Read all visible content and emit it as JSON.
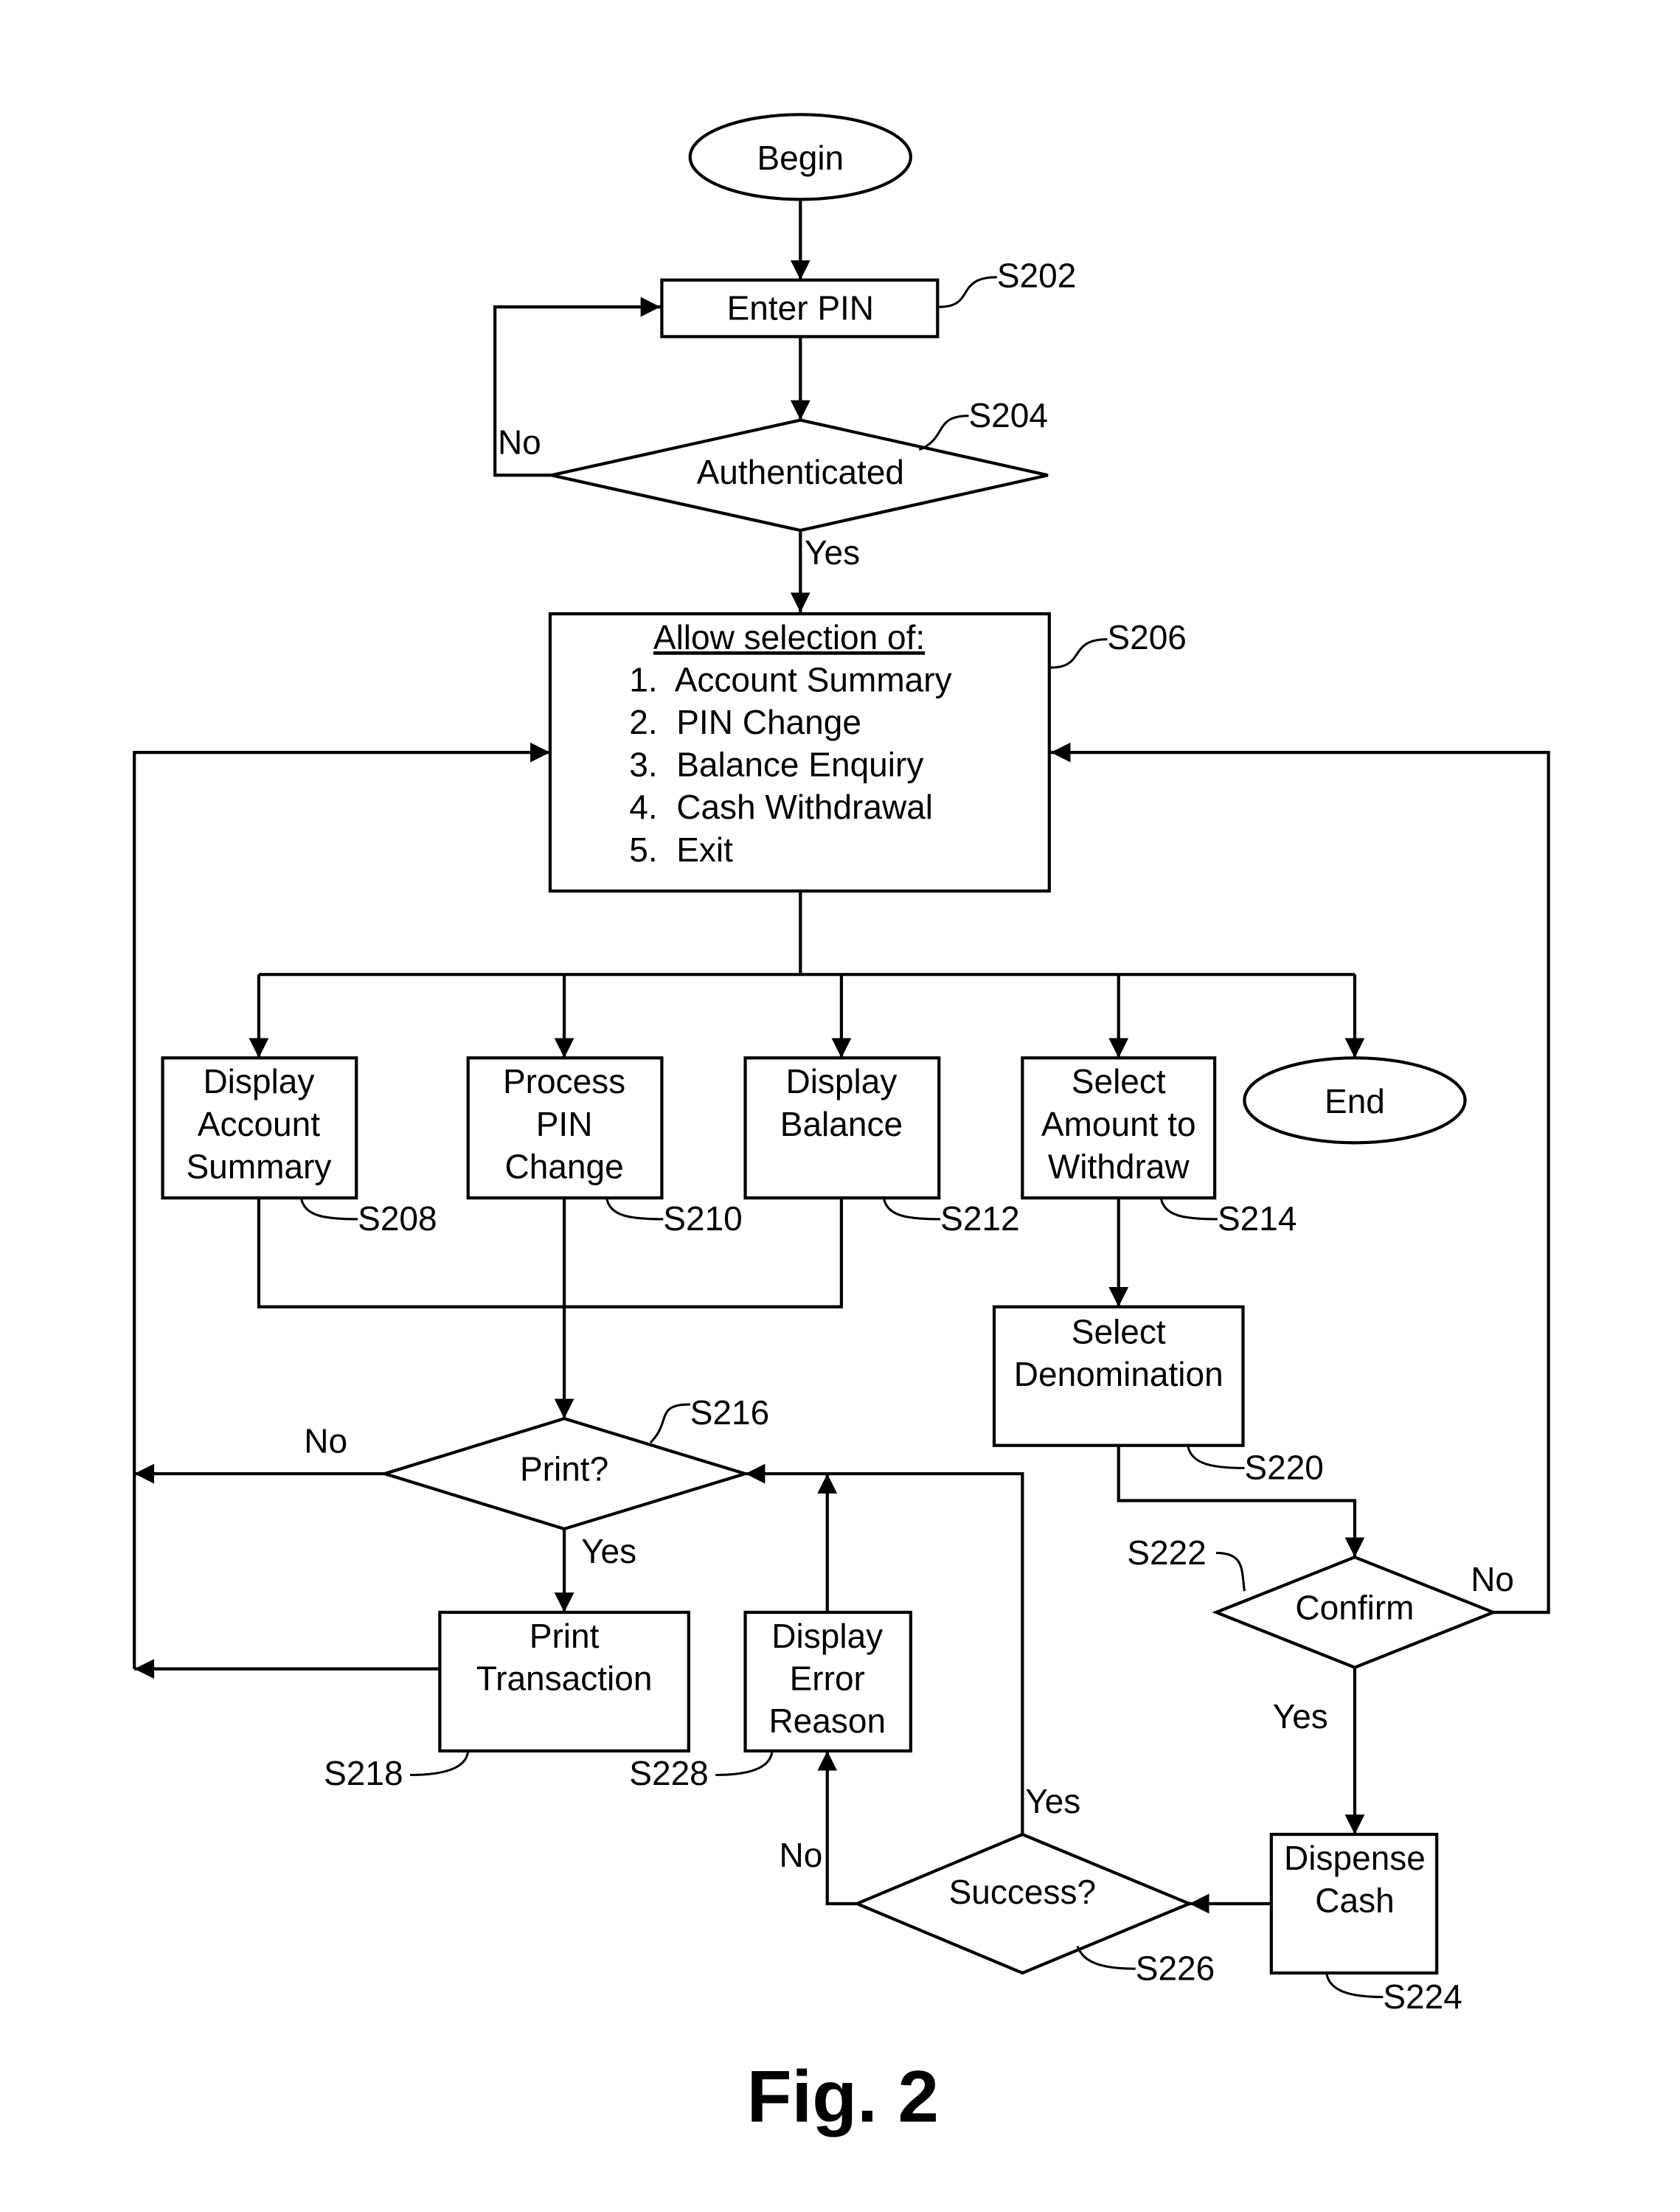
{
  "figure_label": "Fig. 2",
  "nodes": {
    "begin": {
      "text": "Begin"
    },
    "enter_pin": {
      "text": "Enter PIN",
      "ref": "S202"
    },
    "authenticated": {
      "text": "Authenticated",
      "ref": "S204"
    },
    "menu": {
      "title": "Allow selection of:",
      "items": [
        "1.  Account Summary",
        "2.  PIN Change",
        "3.  Balance Enquiry",
        "4.  Cash Withdrawal",
        "5.  Exit"
      ],
      "ref": "S206"
    },
    "display_account_summary": {
      "lines": [
        "Display",
        "Account",
        "Summary"
      ],
      "ref": "S208"
    },
    "process_pin_change": {
      "lines": [
        "Process",
        "PIN",
        "Change"
      ],
      "ref": "S210"
    },
    "display_balance": {
      "lines": [
        "Display",
        "Balance"
      ],
      "ref": "S212"
    },
    "select_amount": {
      "lines": [
        "Select",
        "Amount to",
        "Withdraw"
      ],
      "ref": "S214"
    },
    "end": {
      "text": "End"
    },
    "print_decision": {
      "text": "Print?",
      "ref": "S216"
    },
    "print_transaction": {
      "lines": [
        "Print",
        "Transaction"
      ],
      "ref": "S218"
    },
    "select_denomination": {
      "lines": [
        "Select",
        "Denomination"
      ],
      "ref": "S220"
    },
    "confirm": {
      "text": "Confirm",
      "ref": "S222"
    },
    "dispense_cash": {
      "lines": [
        "Dispense",
        "Cash"
      ],
      "ref": "S224"
    },
    "success_decision": {
      "text": "Success?",
      "ref": "S226"
    },
    "display_error": {
      "lines": [
        "Display",
        "Error",
        "Reason"
      ],
      "ref": "S228"
    }
  },
  "edge_labels": {
    "auth_no": "No",
    "auth_yes": "Yes",
    "print_no": "No",
    "print_yes": "Yes",
    "confirm_no": "No",
    "confirm_yes": "Yes",
    "success_yes": "Yes",
    "success_no": "No"
  }
}
